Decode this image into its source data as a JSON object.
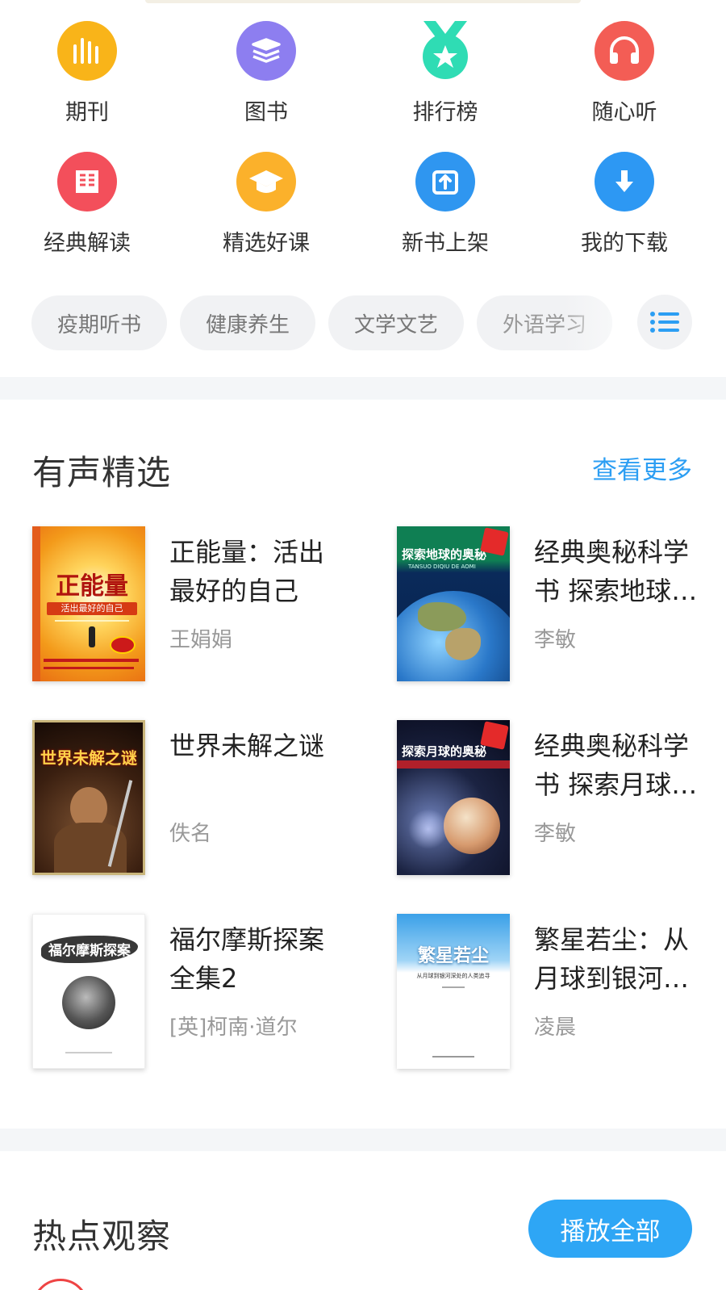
{
  "nav_grid": [
    {
      "label": "期刊",
      "icon": "bars-icon",
      "color": "#f9b419"
    },
    {
      "label": "图书",
      "icon": "book-stack-icon",
      "color": "#8d7ef0"
    },
    {
      "label": "排行榜",
      "icon": "medal-icon",
      "color": "#2fdcb4"
    },
    {
      "label": "随心听",
      "icon": "headphones-icon",
      "color": "#f35d55"
    },
    {
      "label": "经典解读",
      "icon": "open-book-icon",
      "color": "#f34f5b"
    },
    {
      "label": "精选好课",
      "icon": "graduation-cap-icon",
      "color": "#fbb12b"
    },
    {
      "label": "新书上架",
      "icon": "upload-box-icon",
      "color": "#2f96f0"
    },
    {
      "label": "我的下载",
      "icon": "download-icon",
      "color": "#2d98f3"
    }
  ],
  "categories": [
    "疫期听书",
    "健康养生",
    "文学文艺",
    "外语学习"
  ],
  "audio_section": {
    "title": "有声精选",
    "more_label": "查看更多",
    "books": [
      {
        "title": "正能量：活出最好的自己",
        "author": "王娟娟"
      },
      {
        "title": "经典奥秘科学书 探索地球的奥秘",
        "author": "李敏"
      },
      {
        "title": "世界未解之谜",
        "author": "佚名"
      },
      {
        "title": "经典奥秘科学书 探索月球的奥秘",
        "author": "李敏"
      },
      {
        "title": "福尔摩斯探案全集2",
        "author": "[英]柯南·道尔"
      },
      {
        "title": "繁星若尘：从月球到银河深处的人类追寻",
        "author": "凌晨"
      }
    ]
  },
  "hot_section": {
    "title": "热点观察",
    "play_all_label": "播放全部"
  },
  "cover_text": {
    "book1_main": "正能量",
    "book1_sub": "活出最好的自己",
    "book2_main": "探索地球的奥秘",
    "book2_sub": "TANSUO DIQIU DE AOMI",
    "book3_main": "世界未解之谜",
    "book4_main": "探索月球的奥秘",
    "book5_main": "福尔摩斯探案",
    "book6_main": "繁星若尘",
    "book6_sub": "从月球到银河深处的人类追寻"
  },
  "colors": {
    "accent": "#2ea6f5",
    "link": "#2c9ef3"
  }
}
